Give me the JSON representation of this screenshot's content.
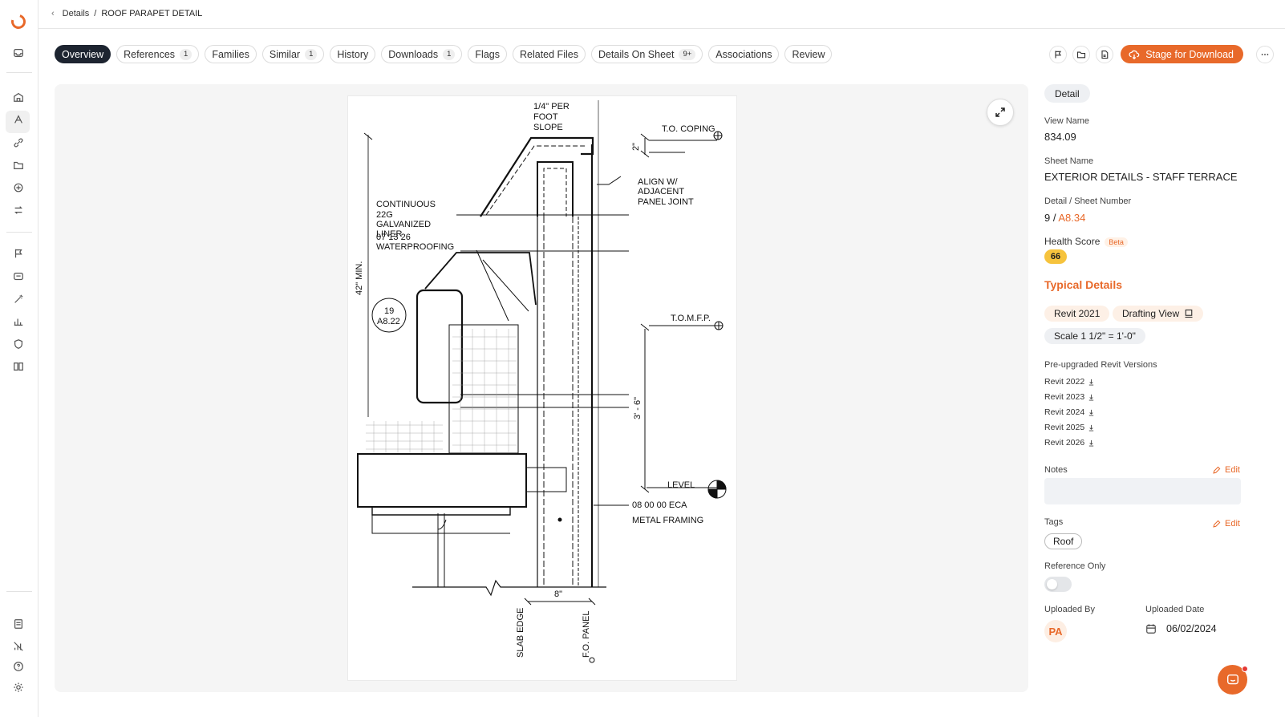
{
  "breadcrumb": {
    "parent": "Details",
    "separator": "/",
    "current": "ROOF PARAPET DETAIL"
  },
  "tabs": [
    {
      "label": "Overview",
      "count": null,
      "active": true
    },
    {
      "label": "References",
      "count": "1"
    },
    {
      "label": "Families",
      "count": null
    },
    {
      "label": "Similar",
      "count": "1"
    },
    {
      "label": "History",
      "count": null
    },
    {
      "label": "Downloads",
      "count": "1"
    },
    {
      "label": "Flags",
      "count": null
    },
    {
      "label": "Related Files",
      "count": null
    },
    {
      "label": "Details On Sheet",
      "count": "9+"
    },
    {
      "label": "Associations",
      "count": null
    },
    {
      "label": "Review",
      "count": null
    }
  ],
  "actions": {
    "flag_icon": "flag-icon",
    "folder_icon": "folder-icon",
    "file_icon": "file-icon",
    "stage_label": "Stage for Download",
    "more_icon": "more-icon"
  },
  "drawing": {
    "labels": {
      "slope": [
        "1/4\" PER",
        "FOOT",
        "SLOPE"
      ],
      "coping": "T.O. COPING",
      "dim_2": "2\"",
      "align": [
        "ALIGN W/",
        "ADJACENT",
        "PANEL JOINT"
      ],
      "liner": [
        "CONTINUOUS",
        "22G",
        "GALVANIZED",
        "LINER"
      ],
      "liner_ref": "07 13 26",
      "waterproofing": "WATERPROOFING",
      "min42": "42\" MIN.",
      "callout_num": "19",
      "callout_sheet": "A8.22",
      "tomfp": "T.O.M.F.P.",
      "dim_36": "3' - 6\"",
      "level": "LEVEL",
      "eca": "08 00 00 ECA",
      "framing": "METAL FRAMING",
      "dim_8": "8\"",
      "slab_edge": "SLAB EDGE",
      "fo_panel": "F.O. PANEL"
    }
  },
  "panel": {
    "tab": "Detail",
    "view_name_label": "View Name",
    "view_name": "834.09",
    "sheet_name_label": "Sheet Name",
    "sheet_name": "EXTERIOR DETAILS - STAFF TERRACE",
    "detail_sheet_label": "Detail / Sheet Number",
    "detail_number": "9 /",
    "sheet_number": "A8.34",
    "health_label": "Health Score",
    "beta": "Beta",
    "health_score": "66",
    "typical_details": "Typical Details",
    "chips": {
      "revit": "Revit 2021",
      "view_type": "Drafting View",
      "scale": "Scale 1 1/2\" = 1'-0\""
    },
    "pre_upgraded_label": "Pre-upgraded Revit Versions",
    "versions": [
      "Revit 2022",
      "Revit 2023",
      "Revit 2024",
      "Revit 2025",
      "Revit 2026"
    ],
    "notes_label": "Notes",
    "edit": "Edit",
    "tags_label": "Tags",
    "tags": [
      "Roof"
    ],
    "reference_only_label": "Reference Only",
    "reference_only": false,
    "uploaded_by_label": "Uploaded By",
    "uploaded_by_initials": "PA",
    "uploaded_date_label": "Uploaded Date",
    "uploaded_date": "06/02/2024"
  },
  "colors": {
    "accent": "#e8692a",
    "active_tab": "#1d2430",
    "score": "#f6c33d"
  }
}
